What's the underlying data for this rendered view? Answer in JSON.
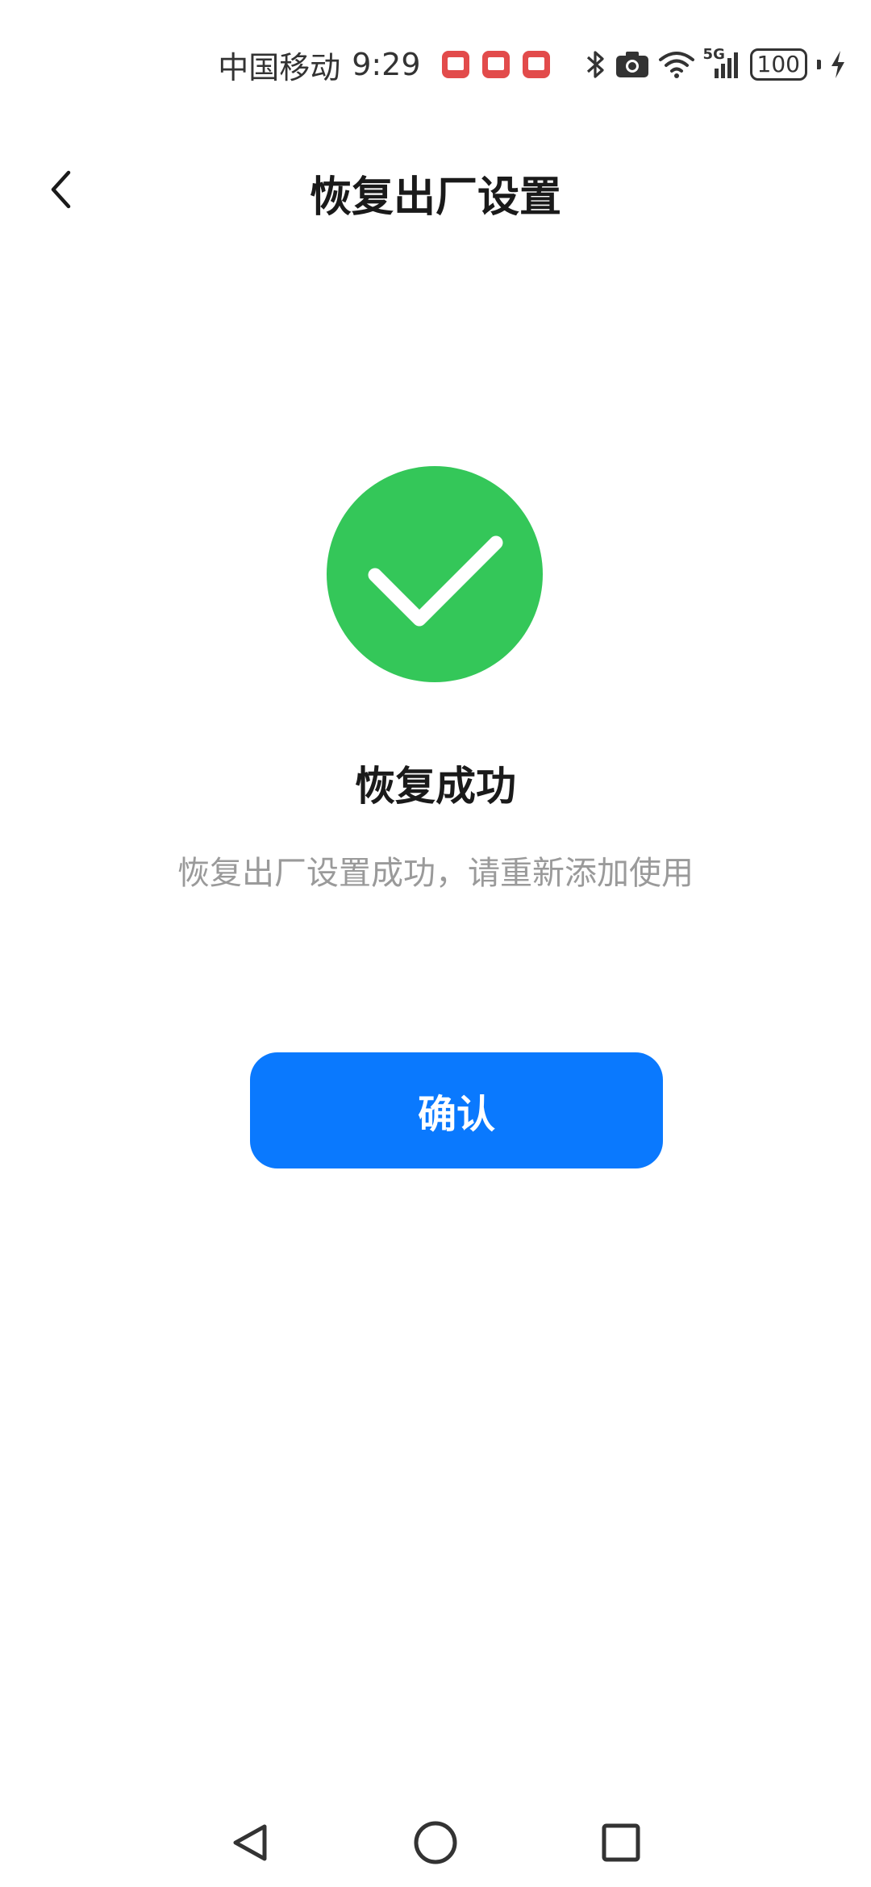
{
  "status_bar": {
    "carrier": "中国移动",
    "time": "9:29",
    "network": "5G",
    "battery": "100"
  },
  "header": {
    "title": "恢复出厂设置"
  },
  "result": {
    "title": "恢复成功",
    "description": "恢复出厂设置成功，请重新添加使用"
  },
  "actions": {
    "confirm_label": "确认"
  },
  "colors": {
    "success_green": "#34c759",
    "primary_blue": "#0a79fe",
    "secondary_text": "#9a9a9a"
  },
  "icons": {
    "back": "chevron-left-icon",
    "success": "check-circle-icon",
    "nav_back": "triangle-back-icon",
    "nav_home": "circle-home-icon",
    "nav_recents": "square-recents-icon"
  }
}
